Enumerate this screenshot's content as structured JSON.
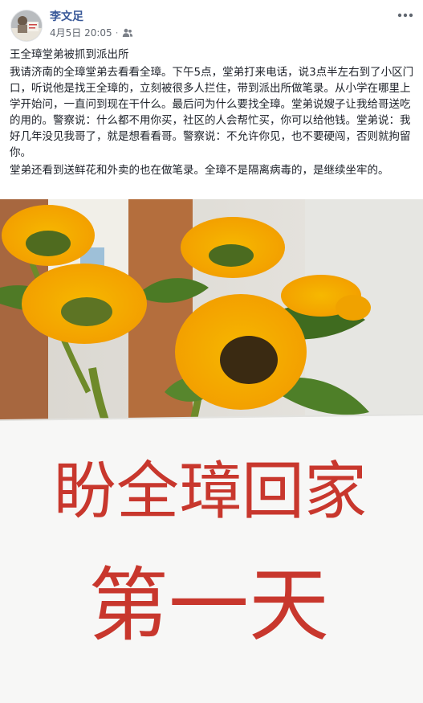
{
  "post": {
    "author": "李文足",
    "date": "4月5日 20:05",
    "separator": "·",
    "audience_icon": "friends-icon",
    "more_icon": "more-horizontal-icon",
    "paragraphs": [
      "王全璋堂弟被抓到派出所",
      "我请济南的全璋堂弟去看看全璋。下午5点，堂弟打来电话，说3点半左右到了小区门口，听说他是找王全璋的，立刻被很多人拦住，带到派出所做笔录。从小学在哪里上学开始问，一直问到现在干什么。最后问为什么要找全璋。堂弟说嫂子让我给哥送吃的用的。警察说：什么都不用你买，社区的人会帮忙买，你可以给他钱。堂弟说：我好几年没见我哥了，就是想看看哥。警察说：不允许你见，也不要硬闯，否则就拘留你。",
      "堂弟还看到送鲜花和外卖的也在做笔录。全璋不是隔离病毒的，是继续坐牢的。"
    ],
    "author_color": "#385898",
    "text_color": "#1d2129",
    "meta_color": "#616770"
  },
  "photo": {
    "sign_line1": "盼全璋回家",
    "sign_line2": "第一天",
    "ink_color": "#c8372d"
  }
}
